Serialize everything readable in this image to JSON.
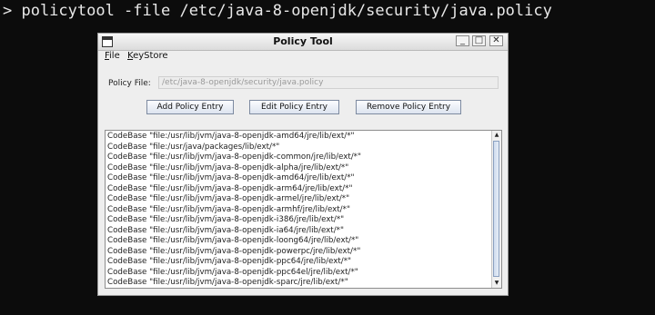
{
  "terminal": {
    "command": "> policytool -file /etc/java-8-openjdk/security/java.policy"
  },
  "window": {
    "title": "Policy Tool",
    "controls": {
      "minimize": "_",
      "maximize": "□",
      "close": "✕"
    }
  },
  "menu": {
    "file": "File",
    "keystore": "KeyStore"
  },
  "policy_file": {
    "label": "Policy File:",
    "value": "/etc/java-8-openjdk/security/java.policy"
  },
  "buttons": {
    "add": "Add Policy Entry",
    "edit": "Edit Policy Entry",
    "remove": "Remove Policy Entry"
  },
  "entries": [
    "CodeBase \"file:/usr/lib/jvm/java-8-openjdk-amd64/jre/lib/ext/*\"",
    "CodeBase \"file:/usr/java/packages/lib/ext/*\"",
    "CodeBase \"file:/usr/lib/jvm/java-8-openjdk-common/jre/lib/ext/*\"",
    "CodeBase \"file:/usr/lib/jvm/java-8-openjdk-alpha/jre/lib/ext/*\"",
    "CodeBase \"file:/usr/lib/jvm/java-8-openjdk-amd64/jre/lib/ext/*\"",
    "CodeBase \"file:/usr/lib/jvm/java-8-openjdk-arm64/jre/lib/ext/*\"",
    "CodeBase \"file:/usr/lib/jvm/java-8-openjdk-armel/jre/lib/ext/*\"",
    "CodeBase \"file:/usr/lib/jvm/java-8-openjdk-armhf/jre/lib/ext/*\"",
    "CodeBase \"file:/usr/lib/jvm/java-8-openjdk-i386/jre/lib/ext/*\"",
    "CodeBase \"file:/usr/lib/jvm/java-8-openjdk-ia64/jre/lib/ext/*\"",
    "CodeBase \"file:/usr/lib/jvm/java-8-openjdk-loong64/jre/lib/ext/*\"",
    "CodeBase \"file:/usr/lib/jvm/java-8-openjdk-powerpc/jre/lib/ext/*\"",
    "CodeBase \"file:/usr/lib/jvm/java-8-openjdk-ppc64/jre/lib/ext/*\"",
    "CodeBase \"file:/usr/lib/jvm/java-8-openjdk-ppc64el/jre/lib/ext/*\"",
    "CodeBase \"file:/usr/lib/jvm/java-8-openjdk-sparc/jre/lib/ext/*\""
  ],
  "scrollbar": {
    "up_icon": "triangle-up",
    "down_icon": "triangle-down"
  }
}
